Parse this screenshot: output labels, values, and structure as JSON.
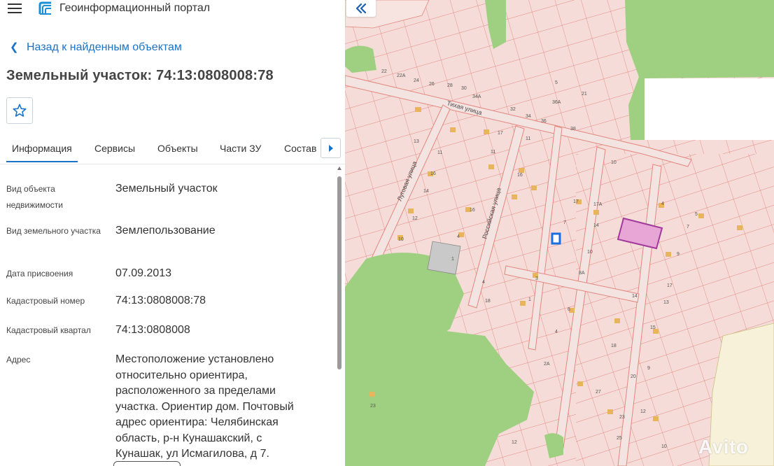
{
  "header": {
    "app_title": "Геоинформационный портал",
    "menu_icon": "hamburger-menu-icon",
    "logo_icon": "portal-logo-icon"
  },
  "nav": {
    "back_label": "Назад к найденным объектам"
  },
  "object": {
    "title": "Земельный участок: 74:13:0808008:78"
  },
  "tabs": [
    {
      "label": "Информация",
      "active": true
    },
    {
      "label": "Сервисы",
      "active": false
    },
    {
      "label": "Объекты",
      "active": false
    },
    {
      "label": "Части ЗУ",
      "active": false
    },
    {
      "label": "Состав",
      "active": false
    }
  ],
  "info": {
    "rows": [
      {
        "label": "Вид объекта недвижимости",
        "value": "Земельный участок"
      },
      {
        "label": "Вид земельного участка",
        "value": "Землепользование"
      },
      {
        "label": "Дата присвоения",
        "value": "07.09.2013"
      },
      {
        "label": "Кадастровый номер",
        "value": "74:13:0808008:78"
      },
      {
        "label": "Кадастровый квартал",
        "value": "74:13:0808008"
      },
      {
        "label": "Адрес",
        "value": "Местоположение установлено относительно ориентира, расположенного за пределами участка. Ориентир дом. Почтовый адрес ориентира: Челябинская область, р-н Кунашакский, с Кунашак, ул Исмагилова, д 7."
      }
    ]
  },
  "map": {
    "streets": [
      "Тихая улица",
      "Луговая улица",
      "Российская улица"
    ],
    "numbers": [
      "22",
      "22А",
      "24",
      "26",
      "28",
      "30",
      "34А",
      "32",
      "34",
      "36",
      "36А",
      "38",
      "5",
      "21",
      "19",
      "17",
      "13",
      "11",
      "16",
      "14",
      "12",
      "10",
      "8",
      "6",
      "4",
      "2",
      "1",
      "3",
      "7",
      "9",
      "15",
      "17А",
      "18",
      "20",
      "23",
      "25",
      "27",
      "2А",
      "8А"
    ],
    "colors": {
      "parcel_fill": "#f4d9d5",
      "parcel_stroke": "#e07a70",
      "green": "#9fcf80",
      "selected_fill": "#e7a6d6",
      "selected_stroke": "#a13a9b",
      "building": "#e8b55c"
    }
  },
  "watermark": "Avito"
}
